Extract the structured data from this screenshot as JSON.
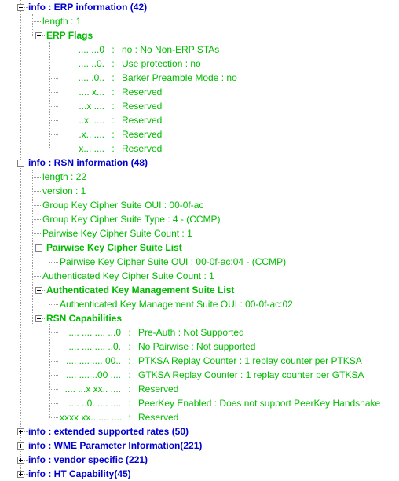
{
  "view": {
    "name": "packet-detail-tree",
    "background": "#ffffff",
    "node_color": "#0000d0",
    "field_color": "#00bb00",
    "line_color": "#9a9a9a"
  },
  "nodes": [
    {
      "id": "erp",
      "label": "info : ERP information (42)",
      "expander": "minus",
      "children": [
        {
          "id": "erp-length",
          "label": "length : 1"
        },
        {
          "id": "erp-flags",
          "label": "ERP Flags",
          "expander": "minus",
          "bits": [
            {
              "pattern": ".... ...0",
              "sep": ":",
              "desc": "no : No Non-ERP STAs"
            },
            {
              "pattern": ".... ..0.",
              "sep": ":",
              "desc": "Use protection : no"
            },
            {
              "pattern": ".... .0..",
              "sep": ":",
              "desc": "Barker Preamble Mode : no"
            },
            {
              "pattern": ".... x...",
              "sep": ":",
              "desc": "Reserved"
            },
            {
              "pattern": "...x ....",
              "sep": ":",
              "desc": "Reserved"
            },
            {
              "pattern": "..x. ....",
              "sep": ":",
              "desc": "Reserved"
            },
            {
              "pattern": ".x.. ....",
              "sep": ":",
              "desc": "Reserved"
            },
            {
              "pattern": "x... ....",
              "sep": ":",
              "desc": "Reserved"
            }
          ]
        }
      ]
    },
    {
      "id": "rsn",
      "label": "info : RSN information (48)",
      "expander": "minus",
      "children": [
        {
          "id": "rsn-length",
          "label": "length : 22"
        },
        {
          "id": "rsn-version",
          "label": "version : 1"
        },
        {
          "id": "rsn-gk-oui",
          "label": "Group Key Cipher Suite OUI : 00-0f-ac"
        },
        {
          "id": "rsn-gk-type",
          "label": "Group Key Cipher Suite Type : 4 - (CCMP)"
        },
        {
          "id": "rsn-pw-count",
          "label": "Pairwise Key Cipher Suite Count : 1"
        },
        {
          "id": "rsn-pw-list",
          "label": "Pairwise Key Cipher Suite List",
          "expander": "minus",
          "leaf_children": [
            "Pairwise Key Cipher Suite OUI : 00-0f-ac:04 - (CCMP)"
          ]
        },
        {
          "id": "rsn-akm-count",
          "label": "Authenticated Key Cipher Suite Count : 1"
        },
        {
          "id": "rsn-akm-list",
          "label": "Authenticated Key Management Suite List",
          "expander": "minus",
          "leaf_children": [
            "Authenticated Key Management Suite OUI : 00-0f-ac:02"
          ]
        },
        {
          "id": "rsn-caps",
          "label": "RSN Capabilities",
          "expander": "minus",
          "bits": [
            {
              "pattern": ".... .... .... ...0",
              "sep": ":",
              "desc": "Pre-Auth : Not Supported"
            },
            {
              "pattern": ".... .... .... ..0.",
              "sep": ":",
              "desc": "No Pairwise : Not supported"
            },
            {
              "pattern": ".... .... .... 00..",
              "sep": ":",
              "desc": "PTKSA Replay Counter : 1 replay counter per PTKSA"
            },
            {
              "pattern": ".... .... ..00 ....",
              "sep": ":",
              "desc": "GTKSA Replay Counter : 1 replay counter per GTKSA"
            },
            {
              "pattern": ".... ...x xx.. ....",
              "sep": ":",
              "desc": "Reserved"
            },
            {
              "pattern": ".... ..0. .... ....",
              "sep": ":",
              "desc": "PeerKey Enabled : Does not support PeerKey Handshake"
            },
            {
              "pattern": "xxxx xx.. .... ....",
              "sep": ":",
              "desc": "Reserved"
            }
          ]
        }
      ]
    },
    {
      "id": "ext-rates",
      "label": "info : extended supported rates (50)",
      "expander": "plus"
    },
    {
      "id": "wme",
      "label": "info : WME Parameter Information(221)",
      "expander": "plus"
    },
    {
      "id": "vendor",
      "label": "info : vendor specific (221)",
      "expander": "plus"
    },
    {
      "id": "ht-cap",
      "label": "info : HT Capability(45)",
      "expander": "plus"
    }
  ]
}
